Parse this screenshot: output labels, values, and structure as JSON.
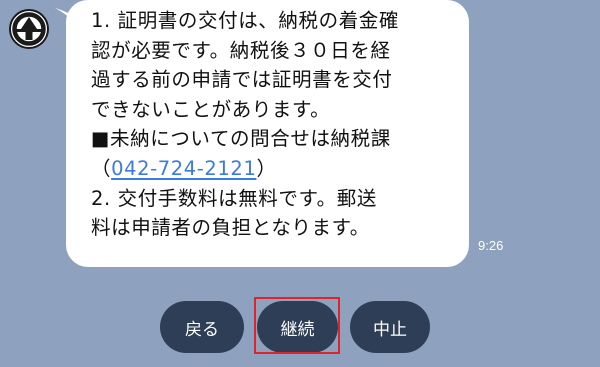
{
  "avatar": {
    "icon": "city-emblem-icon"
  },
  "message": {
    "lines": [
      "1.  証明書の交付は、納税の着金確",
      "認が必要です。納税後３０日を経",
      "過する前の申請では証明書を交付",
      "できないことがあります。",
      "■未納についての問合せは納税課",
      "（",
      "042-724-2121",
      "）",
      "2.   交付手数料は無料です。郵送",
      "料は申請者の負担となります。"
    ],
    "time": "9:26"
  },
  "quick_replies": {
    "back": "戻る",
    "continue": "継続",
    "stop": "中止"
  },
  "colors": {
    "background": "#8ea1be",
    "button": "#2d3e56",
    "link": "#3b7be0",
    "highlight": "#e0242c"
  }
}
